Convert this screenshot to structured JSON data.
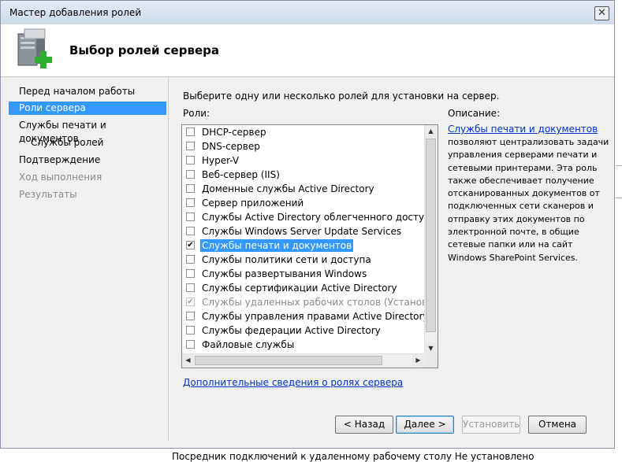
{
  "window": {
    "title": "Мастер добавления ролей",
    "close_glyph": "✕"
  },
  "header": {
    "title": "Выбор ролей сервера",
    "icon": "server-add-icon"
  },
  "nav": {
    "items": [
      {
        "label": "Перед началом работы"
      },
      {
        "label": "Роли сервера"
      },
      {
        "label": "Службы печати и документов"
      },
      {
        "label": "Службы ролей"
      },
      {
        "label": "Подтверждение"
      },
      {
        "label": "Ход выполнения"
      },
      {
        "label": "Результаты"
      }
    ]
  },
  "main": {
    "instruction": "Выберите одну или несколько ролей для установки на сервер.",
    "roles_label": "Роли:",
    "roles": [
      {
        "label": "DHCP-сервер",
        "checked": false
      },
      {
        "label": "DNS-сервер",
        "checked": false
      },
      {
        "label": "Hyper-V",
        "checked": false
      },
      {
        "label": "Веб-сервер (IIS)",
        "checked": false
      },
      {
        "label": "Доменные службы Active Directory",
        "checked": false
      },
      {
        "label": "Сервер приложений",
        "checked": false
      },
      {
        "label": "Службы Active Directory облегченного доступа к ка",
        "checked": false
      },
      {
        "label": "Службы Windows Server Update Services",
        "checked": false
      },
      {
        "label": "Службы печати и документов",
        "checked": true,
        "selected": true
      },
      {
        "label": "Службы политики сети и доступа",
        "checked": false
      },
      {
        "label": "Службы развертывания Windows",
        "checked": false
      },
      {
        "label": "Службы сертификации Active Directory",
        "checked": false
      },
      {
        "label": "Службы удаленных рабочих столов  (Установлено)",
        "checked": true,
        "disabled": true
      },
      {
        "label": "Службы управления правами Active Directory",
        "checked": false
      },
      {
        "label": "Службы федерации Active Directory",
        "checked": false
      },
      {
        "label": "Файловые службы",
        "checked": false
      }
    ],
    "description_title": "Описание:",
    "description_link": "Службы печати и документов",
    "description_text": "позволяют централизовать задачи управления серверами печати и сетевыми принтерами. Эта роль также обеспечивает получение отсканированных документов от подключенных сети сканеров и отправку этих документов по электронной почте, в общие сетевые папки или на сайт Windows SharePoint Services.",
    "more_info_link": "Дополнительные сведения о ролях сервера"
  },
  "buttons": {
    "back": "< Назад",
    "next": "Далее >",
    "install": "Установить",
    "cancel": "Отмена"
  },
  "background": {
    "status_text": "Посредник подключений к удаленному рабочему столу   Не установлено"
  },
  "colors": {
    "selection": "#3399ff",
    "link": "#0033cc"
  }
}
